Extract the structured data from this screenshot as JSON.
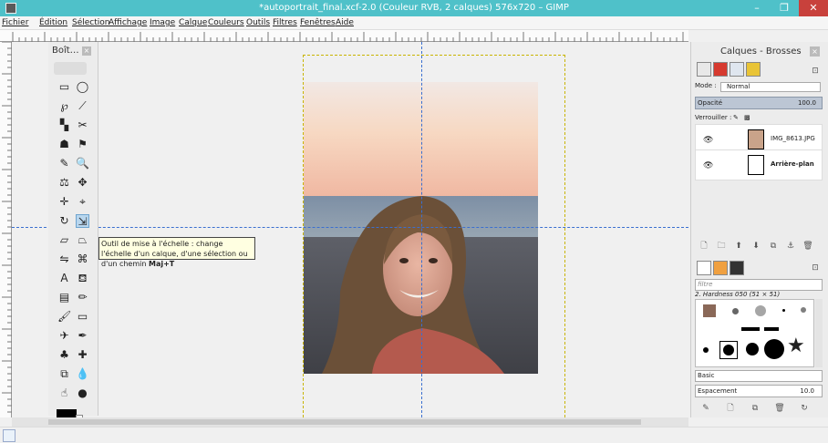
{
  "window": {
    "title": "*autoportrait_final.xcf-2.0 (Couleur RVB, 2 calques) 576x720 – GIMP",
    "minimize_glyph": "–",
    "maximize_glyph": "❐",
    "close_glyph": "✕"
  },
  "menu": [
    {
      "label": "Fichier"
    },
    {
      "label": "Édition"
    },
    {
      "label": "Sélection"
    },
    {
      "label": "Affichage"
    },
    {
      "label": "Image"
    },
    {
      "label": "Calque"
    },
    {
      "label": "Couleurs"
    },
    {
      "label": "Outils"
    },
    {
      "label": "Filtres"
    },
    {
      "label": "Fenêtres"
    },
    {
      "label": "Aide"
    }
  ],
  "toolbox": {
    "title": "Boît…",
    "close_glyph": "×",
    "tools": [
      {
        "icon": "rect-select-icon",
        "glyph": "▭"
      },
      {
        "icon": "ellipse-select-icon",
        "glyph": "◯"
      },
      {
        "icon": "free-select-icon",
        "glyph": "℘"
      },
      {
        "icon": "fuzzy-select-icon",
        "glyph": "⟋"
      },
      {
        "icon": "color-select-icon",
        "glyph": "▚"
      },
      {
        "icon": "scissors-icon",
        "glyph": "✂"
      },
      {
        "icon": "foreground-select-icon",
        "glyph": "☗"
      },
      {
        "icon": "paths-icon",
        "glyph": "⚑"
      },
      {
        "icon": "color-picker-icon",
        "glyph": "✎"
      },
      {
        "icon": "zoom-icon",
        "glyph": "🔍"
      },
      {
        "icon": "measure-icon",
        "glyph": "⚖"
      },
      {
        "icon": "move-icon",
        "glyph": "✥"
      },
      {
        "icon": "align-icon",
        "glyph": "✛"
      },
      {
        "icon": "crop-icon",
        "glyph": "⌖"
      },
      {
        "icon": "rotate-icon",
        "glyph": "↻"
      },
      {
        "icon": "scale-icon",
        "glyph": "⇲"
      },
      {
        "icon": "shear-icon",
        "glyph": "▱"
      },
      {
        "icon": "perspective-icon",
        "glyph": "⏢"
      },
      {
        "icon": "flip-icon",
        "glyph": "⇋"
      },
      {
        "icon": "cage-icon",
        "glyph": "⌘"
      },
      {
        "icon": "text-icon",
        "glyph": "A"
      },
      {
        "icon": "bucket-fill-icon",
        "glyph": "⛾"
      },
      {
        "icon": "blend-icon",
        "glyph": "▤"
      },
      {
        "icon": "pencil-icon",
        "glyph": "✏"
      },
      {
        "icon": "paintbrush-icon",
        "glyph": "🖌"
      },
      {
        "icon": "eraser-icon",
        "glyph": "▭"
      },
      {
        "icon": "airbrush-icon",
        "glyph": "✈"
      },
      {
        "icon": "ink-icon",
        "glyph": "✒"
      },
      {
        "icon": "clone-icon",
        "glyph": "♣"
      },
      {
        "icon": "heal-icon",
        "glyph": "✚"
      },
      {
        "icon": "perspective-clone-icon",
        "glyph": "⧉"
      },
      {
        "icon": "blur-icon",
        "glyph": "💧"
      },
      {
        "icon": "smudge-icon",
        "glyph": "☝"
      },
      {
        "icon": "dodge-burn-icon",
        "glyph": "●"
      }
    ],
    "selected_tool": "scale-icon",
    "fg_color": "#000000",
    "bg_color": "#ffffff"
  },
  "tooltip": {
    "text": "Outil de mise à l'échelle : change l'échelle d'un calque, d'une sélection ou d'un chemin",
    "shortcut": "Maj+T"
  },
  "dock": {
    "title": "Calques - Brosses",
    "close_glyph": "×",
    "mode_label": "Mode :",
    "mode_value": "Normal",
    "opacity_label": "Opacité",
    "opacity_value": "100.0",
    "lock_label": "Verrouiller :",
    "layers": [
      {
        "name": "IMG_8613.JPG",
        "bold": false
      },
      {
        "name": "Arrière-plan",
        "bold": true
      }
    ],
    "layer_buttons": [
      {
        "icon": "new-layer-icon",
        "glyph": "🗋"
      },
      {
        "icon": "new-layer-group-icon",
        "glyph": "🗀"
      },
      {
        "icon": "raise-layer-icon",
        "glyph": "⬆"
      },
      {
        "icon": "lower-layer-icon",
        "glyph": "⬇"
      },
      {
        "icon": "duplicate-layer-icon",
        "glyph": "⧉"
      },
      {
        "icon": "anchor-layer-icon",
        "glyph": "⚓"
      },
      {
        "icon": "delete-layer-icon",
        "glyph": "🗑"
      }
    ],
    "filter_placeholder": "filtre",
    "brush_name": "2. Hardness 050 (51 × 51)",
    "preset": "Basic",
    "spacing_label": "Espacement",
    "spacing_value": "10.0",
    "brush_buttons": [
      {
        "icon": "edit-brush-icon",
        "glyph": "✎"
      },
      {
        "icon": "new-brush-icon",
        "glyph": "🗋"
      },
      {
        "icon": "duplicate-brush-icon",
        "glyph": "⧉"
      },
      {
        "icon": "delete-brush-icon",
        "glyph": "🗑"
      },
      {
        "icon": "refresh-brushes-icon",
        "glyph": "↻"
      }
    ]
  }
}
